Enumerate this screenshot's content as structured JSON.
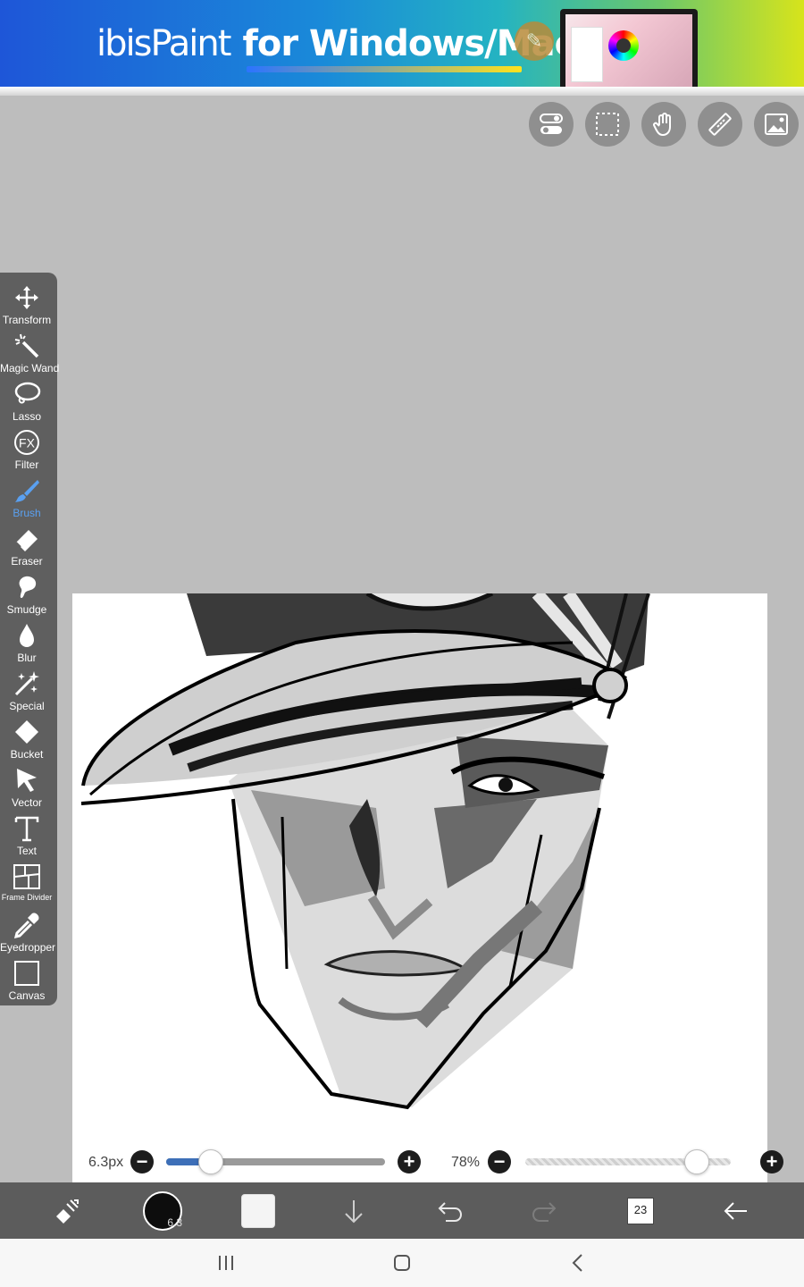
{
  "ad": {
    "brand": "ibisPaint",
    "text": "for Windows/Mac",
    "colors": {
      "start": "#1e56d8",
      "end": "#d7e41b"
    }
  },
  "top_tools": [
    {
      "name": "toggle-icon"
    },
    {
      "name": "selection-icon"
    },
    {
      "name": "hand-icon"
    },
    {
      "name": "ruler-icon"
    },
    {
      "name": "reference-image-icon"
    }
  ],
  "toolbar": {
    "tools": [
      {
        "label": "Transform",
        "icon": "move-icon"
      },
      {
        "label": "Magic Wand",
        "icon": "magic-wand-icon"
      },
      {
        "label": "Lasso",
        "icon": "lasso-icon"
      },
      {
        "label": "Filter",
        "icon": "fx-icon"
      },
      {
        "label": "Brush",
        "icon": "brush-icon",
        "active": true
      },
      {
        "label": "Eraser",
        "icon": "eraser-icon"
      },
      {
        "label": "Smudge",
        "icon": "smudge-icon"
      },
      {
        "label": "Blur",
        "icon": "droplet-icon"
      },
      {
        "label": "Special",
        "icon": "sparkle-icon"
      },
      {
        "label": "Bucket",
        "icon": "bucket-icon"
      },
      {
        "label": "Vector",
        "icon": "cursor-icon"
      },
      {
        "label": "Text",
        "icon": "text-icon"
      },
      {
        "label": "Frame Divider",
        "icon": "frame-divider-icon"
      },
      {
        "label": "Eyedropper",
        "icon": "eyedropper-icon"
      },
      {
        "label": "Canvas",
        "icon": "canvas-icon"
      }
    ],
    "active_color": "#5aa0f0"
  },
  "brush_size": {
    "value": "6.3px",
    "level": 0.2
  },
  "opacity": {
    "value": "78%",
    "level": 0.78
  },
  "bottom_bar": {
    "brush_size_badge": "6.3",
    "layer_count": "23"
  }
}
